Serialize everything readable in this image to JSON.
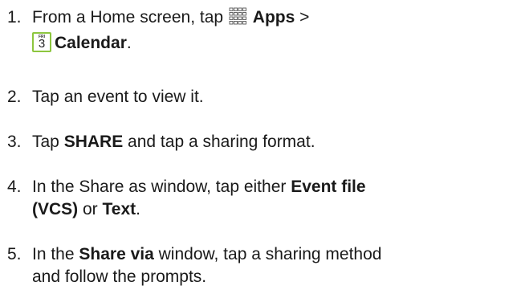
{
  "steps": [
    {
      "number": "1.",
      "line1_pre": "From a Home screen, tap",
      "apps_label": "Apps",
      "line1_post": " >",
      "calendar_label": "Calendar",
      "line2_post": "."
    },
    {
      "number": "2.",
      "text": "Tap an event to view it."
    },
    {
      "number": "3.",
      "pre": "Tap ",
      "bold": "SHARE",
      "post": " and tap a sharing format."
    },
    {
      "number": "4.",
      "pre": "In the Share as window, tap either ",
      "bold1": "Event file",
      "bold2": "(VCS)",
      "mid": " or ",
      "bold3": "Text",
      "post": "."
    },
    {
      "number": "5.",
      "pre": "In the ",
      "bold": "Share via",
      "post": " window, tap a sharing method",
      "line2": "and follow the prompts."
    }
  ],
  "icons": {
    "apps": "apps-grid-icon",
    "calendar": "calendar-icon",
    "calendar_day": "FRI",
    "calendar_date": "3",
    "calendar_border_color": "#8dc63f"
  }
}
